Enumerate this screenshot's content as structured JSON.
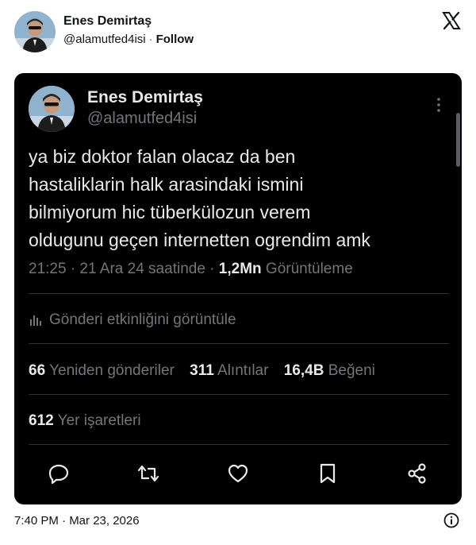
{
  "embed": {
    "author_name": "Enes Demirtaş",
    "handle": "@alamutfed4isi",
    "separator": "·",
    "follow_label": "Follow",
    "timestamp": "7:40 PM · Mar 23, 2026"
  },
  "screenshot": {
    "author_name": "Enes Demirtaş",
    "handle": "@alamutfed4isi",
    "text_lines": [
      "ya biz doktor falan olacaz da ben",
      "hastaliklarin halk arasindaki ismini",
      "bilmiyorum hic tüberkülozun verem",
      "oldugunu geçen internetten ogrendim amk"
    ],
    "meta": {
      "time_date": "21:25 · 21 Ara 24 saatinde ·",
      "views_count": "1,2Mn",
      "views_label": "Görüntüleme"
    },
    "activity_label": "Gönderi etkinliğini görüntüle",
    "stats": {
      "reposts_count": "66",
      "reposts_label": "Yeniden gönderiler",
      "quotes_count": "311",
      "quotes_label": "Alıntılar",
      "likes_count": "16,4B",
      "likes_label": "Beğeni",
      "bookmarks_count": "612",
      "bookmarks_label": "Yer işaretleri"
    }
  },
  "icons": {
    "x_logo": "x-logo-icon",
    "more": "more-vertical-icon",
    "activity": "bar-chart-icon",
    "reply": "reply-icon",
    "repost": "repost-icon",
    "like": "heart-icon",
    "bookmark": "bookmark-icon",
    "share": "share-icon",
    "info": "info-icon"
  },
  "colors": {
    "card_background": "#000000",
    "primary_text_dark": "#e7e9ea",
    "secondary_text_dark": "#71767b",
    "divider_dark": "#2f3336",
    "page_background": "#ffffff",
    "primary_text_light": "#0f1419"
  }
}
